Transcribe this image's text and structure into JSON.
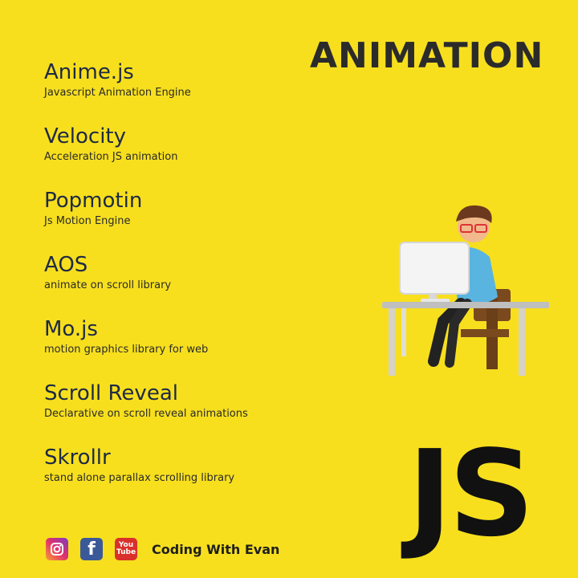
{
  "title": "ANIMATION",
  "libraries": [
    {
      "name": "Anime.js",
      "desc": "Javascript Animation Engine"
    },
    {
      "name": "Velocity",
      "desc": "Acceleration JS animation"
    },
    {
      "name": "Popmotin",
      "desc": "Js Motion Engine"
    },
    {
      "name": "AOS",
      "desc": "animate on scroll library"
    },
    {
      "name": "Mo.js",
      "desc": "motion graphics library for web"
    },
    {
      "name": "Scroll Reveal",
      "desc": "Declarative on scroll reveal animations"
    },
    {
      "name": "Skrollr",
      "desc": "stand alone parallax scrolling library"
    }
  ],
  "logo": "JS",
  "footer": {
    "icons": [
      "instagram-icon",
      "facebook-icon",
      "youtube-icon"
    ],
    "youtube_top": "You",
    "youtube_bottom": "Tube",
    "facebook_glyph": "f",
    "brand": "Coding With Evan"
  },
  "colors": {
    "background": "#f7df1e",
    "text": "#1e2a44",
    "title": "#2b2b2b"
  }
}
